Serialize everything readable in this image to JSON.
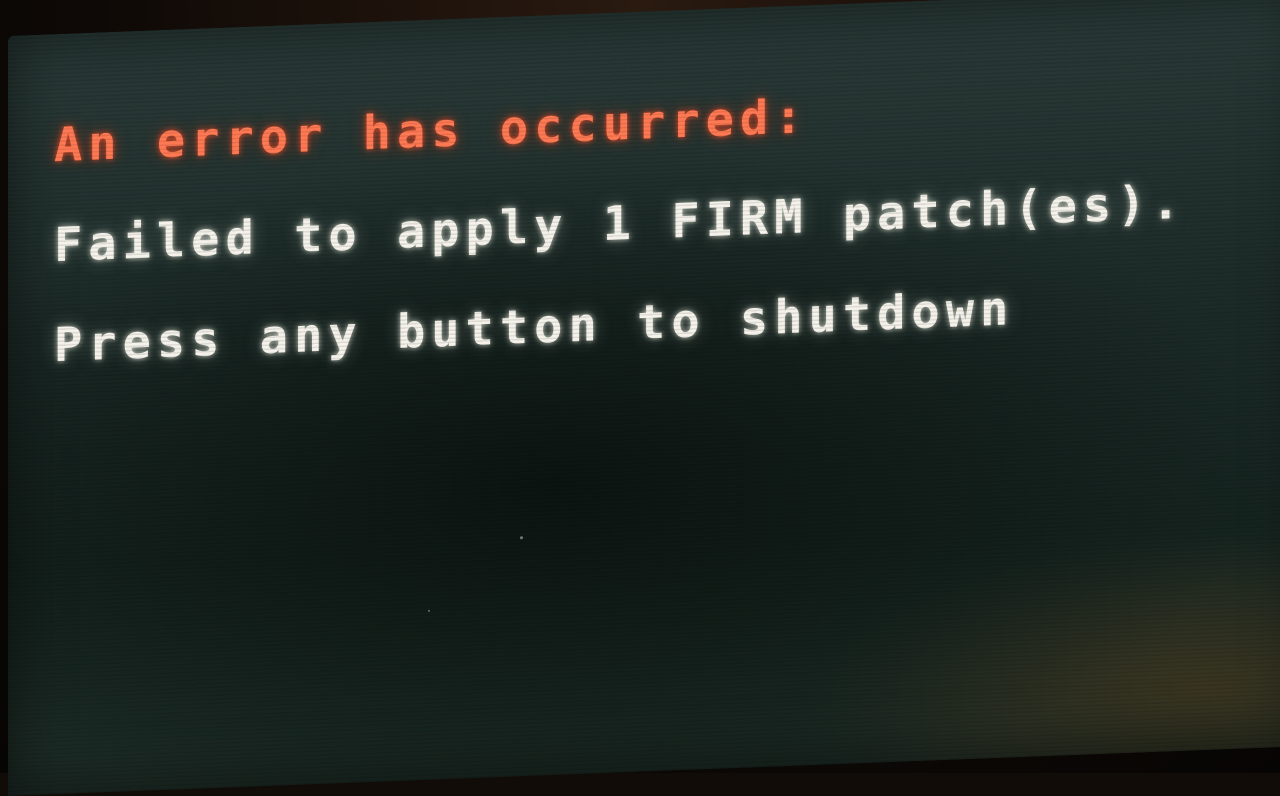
{
  "error_screen": {
    "heading": "An error has occurred:",
    "message": "Failed to apply 1 FIRM patch(es).",
    "prompt": "Press any button to shutdown"
  },
  "colors": {
    "heading": "#ff7a54",
    "body_text": "#f4f2ea",
    "screen_background": "#1d2b28"
  }
}
